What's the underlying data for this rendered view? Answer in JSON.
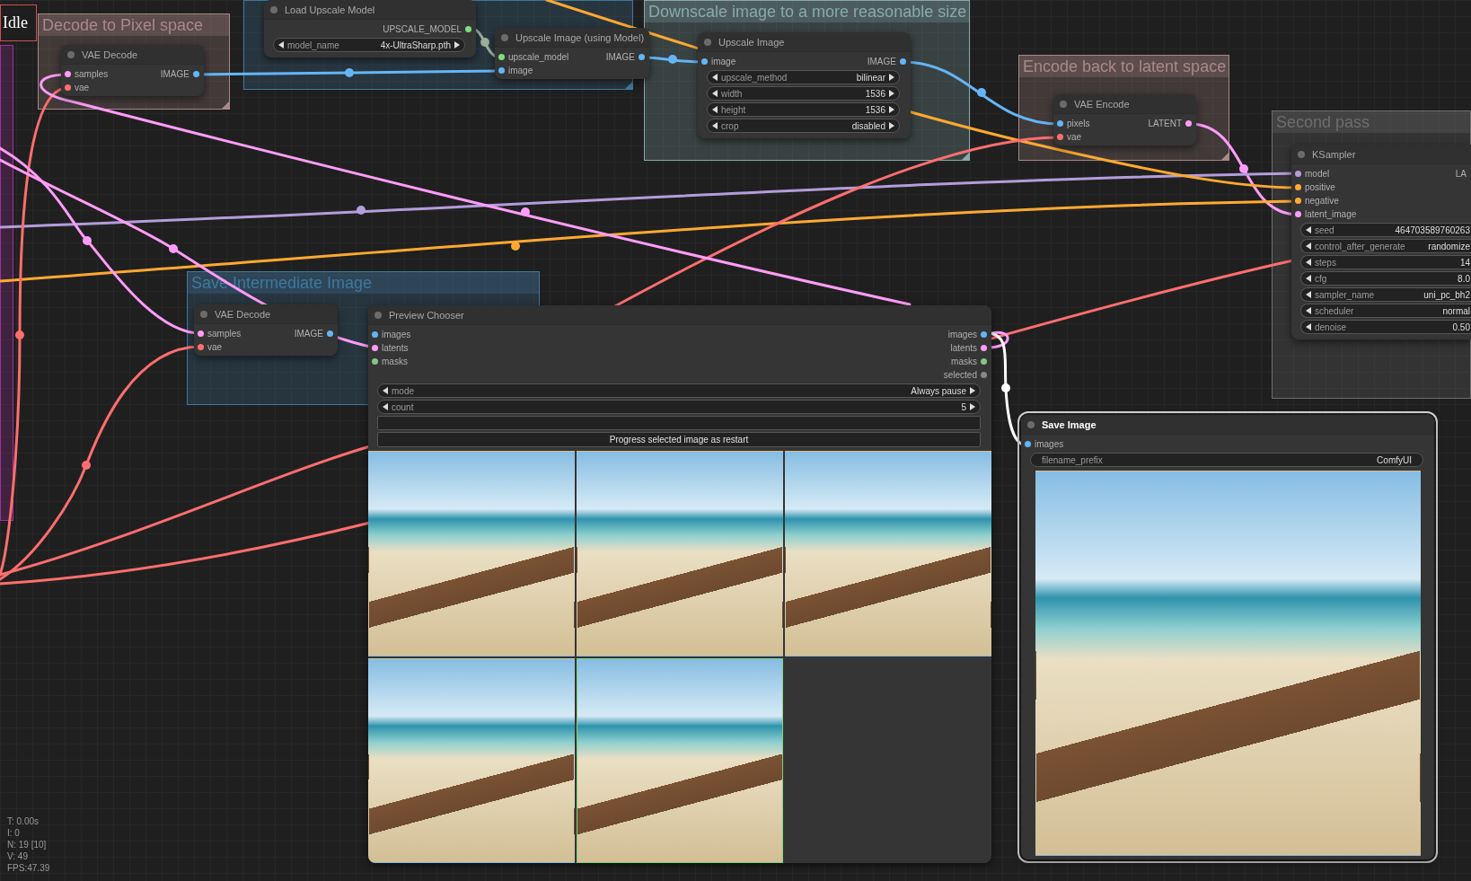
{
  "status": {
    "label": "Idle"
  },
  "groups": [
    {
      "color": "#a1309b",
      "handle": false
    },
    {
      "title": "Decode to Pixel space",
      "color": "#aa8888",
      "handle": true
    },
    {
      "color": "#3f789e",
      "handle": true
    },
    {
      "title": "Downscale image to a more reasonable size",
      "color": "#88aaaa",
      "handle": true
    },
    {
      "title": "Encode back to latent space",
      "color": "#aa8888",
      "handle": true
    },
    {
      "title": "Second pass",
      "color": "#6e6e6e",
      "handle": false
    },
    {
      "title": "Save Intermediate Image",
      "color": "#3f789e",
      "handle": false
    }
  ],
  "nodes": [
    {
      "title": "VAE Decode",
      "selected": false,
      "clipped": false,
      "inputs": [
        {
          "name": "samples",
          "color": "#ff9cf9"
        },
        {
          "name": "vae",
          "color": "#ff6e6e"
        }
      ],
      "outputs": [
        {
          "name": "IMAGE",
          "color": "#64b5f6"
        }
      ]
    },
    {
      "title": "Load Upscale Model",
      "selected": false,
      "clipped": false,
      "outputs": [
        {
          "name": "UPSCALE_MODEL",
          "color": "#7cdf7c"
        }
      ],
      "widgets": [
        {
          "kind": "stepper",
          "label": "model_name",
          "value": "4x-UltraSharp.pth"
        }
      ]
    },
    {
      "title": "Upscale Image (using Model)",
      "selected": false,
      "clipped": false,
      "inputs": [
        {
          "name": "upscale_model",
          "color": "#7cdf7c"
        },
        {
          "name": "image",
          "color": "#64b5f6"
        }
      ],
      "outputs": [
        {
          "name": "IMAGE",
          "color": "#64b5f6"
        }
      ]
    },
    {
      "title": "Upscale Image",
      "selected": false,
      "clipped": false,
      "inputs": [
        {
          "name": "image",
          "color": "#64b5f6"
        }
      ],
      "outputs": [
        {
          "name": "IMAGE",
          "color": "#64b5f6"
        }
      ],
      "widgets": [
        {
          "kind": "stepper",
          "label": "upscale_method",
          "value": "bilinear"
        },
        {
          "kind": "stepper",
          "label": "width",
          "value": "1536"
        },
        {
          "kind": "stepper",
          "label": "height",
          "value": "1536"
        },
        {
          "kind": "stepper",
          "label": "crop",
          "value": "disabled"
        }
      ]
    },
    {
      "title": "VAE Encode",
      "selected": false,
      "clipped": false,
      "inputs": [
        {
          "name": "pixels",
          "color": "#64b5f6"
        },
        {
          "name": "vae",
          "color": "#ff6e6e"
        }
      ],
      "outputs": [
        {
          "name": "LATENT",
          "color": "#ff9cf9"
        }
      ]
    },
    {
      "title": "KSampler",
      "selected": false,
      "clipped": true,
      "inputs": [
        {
          "name": "model",
          "color": "#b39ddb"
        },
        {
          "name": "positive",
          "color": "#ffa931"
        },
        {
          "name": "negative",
          "color": "#ffa931"
        },
        {
          "name": "latent_image",
          "color": "#ff9cf9"
        }
      ],
      "outputs": [
        {
          "name": "LA"
        }
      ],
      "widgets": [
        {
          "kind": "stepper",
          "label": "seed",
          "value": "464703589760263"
        },
        {
          "kind": "stepper",
          "label": "control_after_generate",
          "value": "randomize"
        },
        {
          "kind": "stepper",
          "label": "steps",
          "value": "14"
        },
        {
          "kind": "stepper",
          "label": "cfg",
          "value": "8.0"
        },
        {
          "kind": "stepper",
          "label": "sampler_name",
          "value": "uni_pc_bh2"
        },
        {
          "kind": "stepper",
          "label": "scheduler",
          "value": "normal"
        },
        {
          "kind": "stepper",
          "label": "denoise",
          "value": "0.50"
        }
      ]
    },
    {
      "title": "VAE Decode",
      "selected": false,
      "clipped": false,
      "inputs": [
        {
          "name": "samples",
          "color": "#ff9cf9"
        },
        {
          "name": "vae",
          "color": "#ff6e6e"
        }
      ],
      "outputs": [
        {
          "name": "IMAGE",
          "color": "#64b5f6"
        }
      ]
    },
    {
      "title": "Preview Chooser",
      "selected": false,
      "clipped": false,
      "inputs": [
        {
          "name": "images",
          "color": "#64b5f6"
        },
        {
          "name": "latents",
          "color": "#ff9cf9"
        },
        {
          "name": "masks",
          "color": "#81c784"
        }
      ],
      "outputs": [
        {
          "name": "images",
          "color": "#64b5f6"
        },
        {
          "name": "latents",
          "color": "#ff9cf9"
        },
        {
          "name": "masks",
          "color": "#81c784"
        },
        {
          "name": "selected",
          "color": "#888888"
        }
      ],
      "widgets": [
        {
          "kind": "stepper",
          "label": "mode",
          "value": "Always pause"
        },
        {
          "kind": "stepper",
          "label": "count",
          "value": "5"
        },
        {
          "kind": "textbox"
        },
        {
          "kind": "button",
          "label": "Progress selected image as restart"
        }
      ],
      "images": [
        {
          "kind": "photo",
          "selected": false
        },
        {
          "kind": "photo",
          "selected": false
        },
        {
          "kind": "photo",
          "selected": false
        },
        {
          "kind": "photo",
          "selected": false
        },
        {
          "kind": "photo",
          "selected": true
        }
      ]
    },
    {
      "title": "Save Image",
      "selected": true,
      "clipped": false,
      "inputs": [
        {
          "name": "images",
          "color": "#64b5f6"
        }
      ],
      "widgets": [
        {
          "kind": "text",
          "label": "filename_prefix",
          "value": "ComfyUI"
        }
      ],
      "images": [
        {
          "kind": "photo"
        }
      ]
    }
  ],
  "stats": [
    "T: 0.00s",
    "I: 0",
    "N: 19 [10]",
    "V: 49",
    "FPS:47.39"
  ]
}
